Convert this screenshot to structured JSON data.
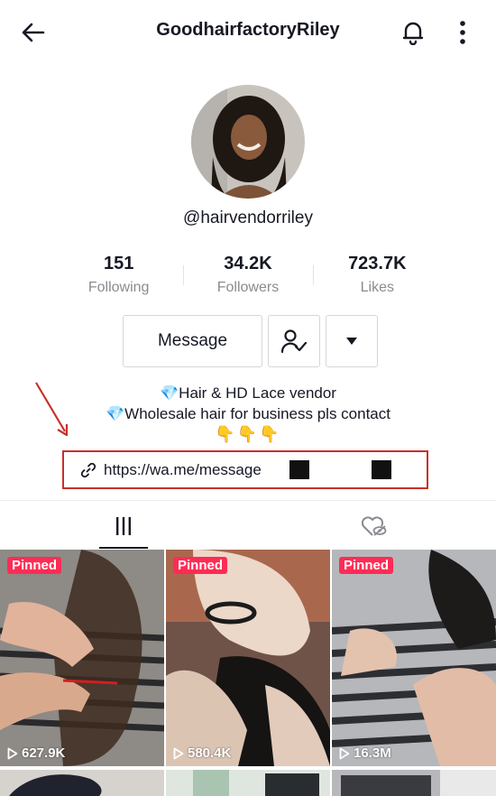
{
  "header": {
    "title": "GoodhairfactoryRiley",
    "back_icon": "arrow-left-icon",
    "bell_icon": "bell-icon",
    "more_icon": "vertical-dots-icon"
  },
  "profile": {
    "handle": "@hairvendorriley",
    "stats": [
      {
        "value": "151",
        "label": "Following"
      },
      {
        "value": "34.2K",
        "label": "Followers"
      },
      {
        "value": "723.7K",
        "label": "Likes"
      }
    ],
    "buttons": {
      "message": "Message",
      "follow_icon": "person-check-icon",
      "dropdown_icon": "caret-down-icon"
    },
    "bio": {
      "line1_emoji": "💎",
      "line1": "Hair & HD Lace vendor",
      "line2_emoji": "💎",
      "line2": "Wholesale hair for business pls contact",
      "line3": "👇👇👇"
    },
    "link": {
      "icon": "link-icon",
      "text": "https://wa.me/message"
    }
  },
  "tabs": [
    {
      "icon": "grid-bars-icon",
      "active": true
    },
    {
      "icon": "heart-hidden-icon",
      "active": false
    }
  ],
  "videos": [
    {
      "badge": "Pinned",
      "views": "627.9K"
    },
    {
      "badge": "Pinned",
      "views": "580.4K"
    },
    {
      "badge": "Pinned",
      "views": "16.3M"
    }
  ],
  "colors": {
    "pinned_badge": "#fe2c55",
    "annotation_red": "#c8302b",
    "text_primary": "#161823",
    "text_secondary": "#8a8b91"
  }
}
